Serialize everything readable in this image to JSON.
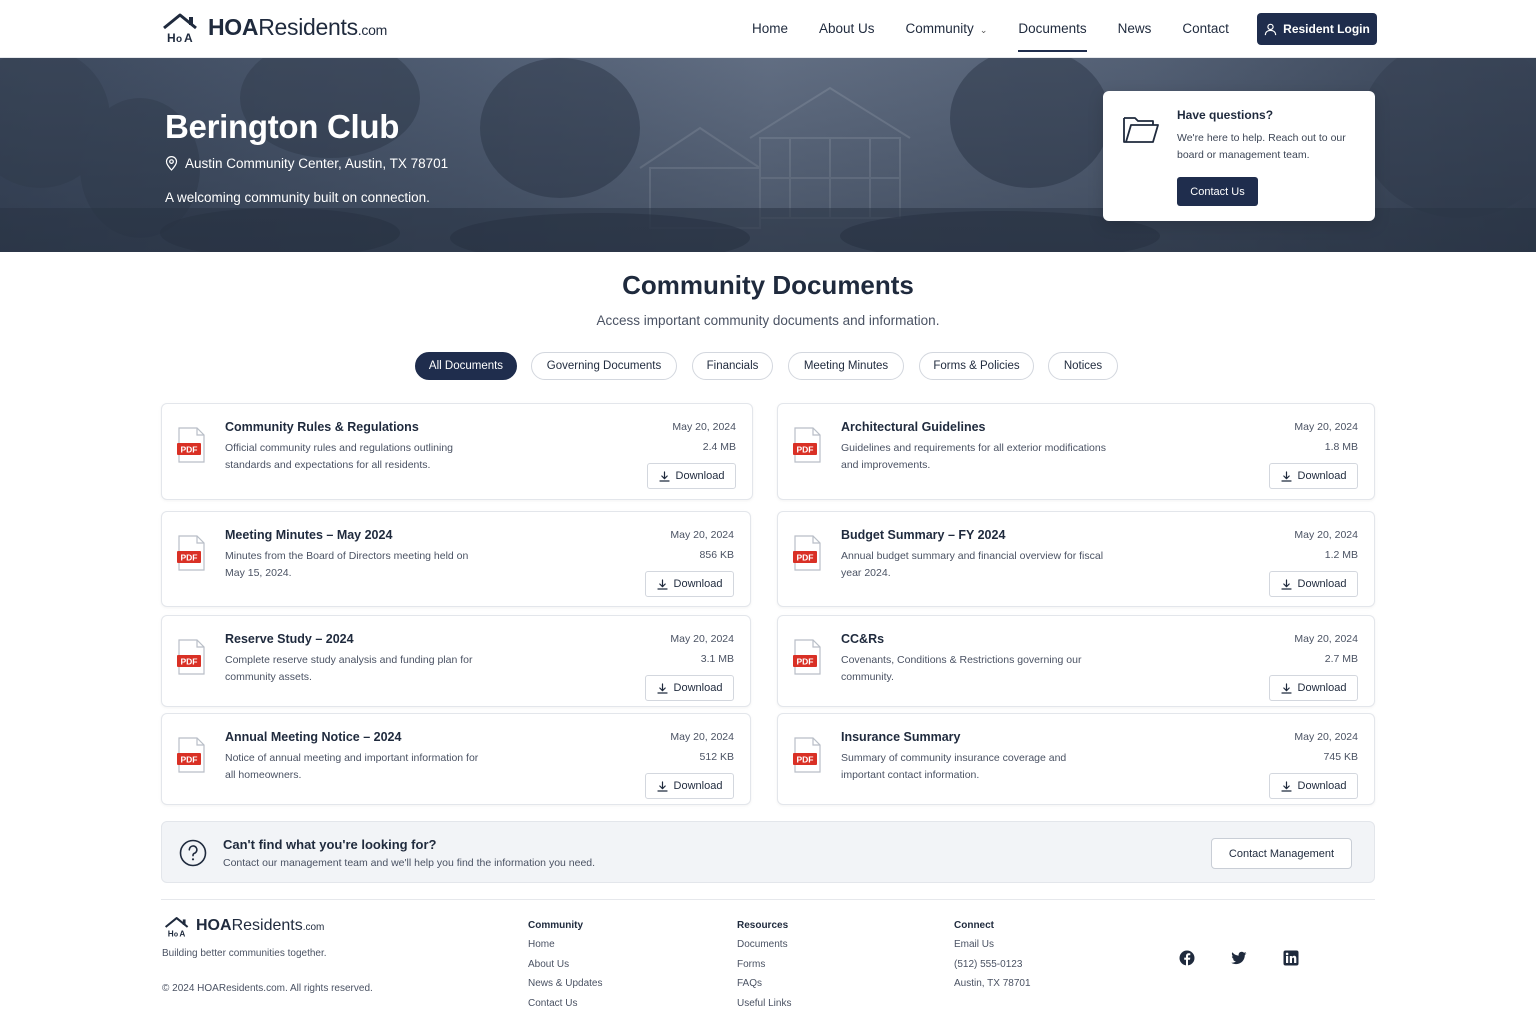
{
  "brand": {
    "name_bold": "HOA",
    "name_rest": "Residents",
    "suffix": ".com"
  },
  "nav": {
    "items": [
      {
        "label": "Home"
      },
      {
        "label": "About Us"
      },
      {
        "label": "Community"
      },
      {
        "label": "Documents"
      },
      {
        "label": "News"
      },
      {
        "label": "Contact"
      }
    ],
    "active": "Documents",
    "login_label": "Resident Login"
  },
  "hero": {
    "title": "Berington Club",
    "location": "Austin Community Center, Austin, TX 78701",
    "tagline": "A welcoming community built on connection.",
    "help": {
      "title": "Have questions?",
      "text": "We're here to help. Reach out to our board or management team.",
      "button": "Contact Us"
    }
  },
  "documents": {
    "title": "Community Documents",
    "subtitle": "Access important community documents and information.",
    "filters": [
      "All Documents",
      "Governing Documents",
      "Financials",
      "Meeting Minutes",
      "Forms & Policies",
      "Notices"
    ],
    "active_filter": "All Documents",
    "download_label": "Download",
    "file_badge": "PDF",
    "items": [
      {
        "title": "Community Rules & Regulations",
        "desc": "Official community rules and regulations outlining standards and expectations for all residents.",
        "date": "May 20, 2024",
        "size": "2.4 MB"
      },
      {
        "title": "Architectural Guidelines",
        "desc": "Guidelines and requirements for all exterior modifications and improvements.",
        "date": "May 20, 2024",
        "size": "1.8 MB"
      },
      {
        "title": "Meeting Minutes – May 2024",
        "desc": "Minutes from the Board of Directors meeting held on May 15, 2024.",
        "date": "May 20, 2024",
        "size": "856 KB"
      },
      {
        "title": "Budget Summary – FY 2024",
        "desc": "Annual budget summary and financial overview for fiscal year 2024.",
        "date": "May 20, 2024",
        "size": "1.2 MB"
      },
      {
        "title": "Reserve Study – 2024",
        "desc": "Complete reserve study analysis and funding plan for community assets.",
        "date": "May 20, 2024",
        "size": "3.1 MB"
      },
      {
        "title": "CC&Rs",
        "desc": "Covenants, Conditions & Restrictions governing our community.",
        "date": "May 20, 2024",
        "size": "2.7 MB"
      },
      {
        "title": "Annual Meeting Notice – 2024",
        "desc": "Notice of annual meeting and important information for all homeowners.",
        "date": "May 20, 2024",
        "size": "512 KB"
      },
      {
        "title": "Insurance Summary",
        "desc": "Summary of community insurance coverage and important contact information.",
        "date": "May 20, 2024",
        "size": "745 KB"
      }
    ]
  },
  "cta": {
    "title": "Can't find what you're looking for?",
    "text": "Contact our management team and we'll help you find the information you need.",
    "button": "Contact Management"
  },
  "footer": {
    "tagline": "Building better communities together.",
    "copyright": "© 2024 HOAResidents.com. All rights reserved.",
    "columns": [
      {
        "heading": "Community",
        "links": [
          "Home",
          "About Us",
          "News & Updates",
          "Contact Us"
        ]
      },
      {
        "heading": "Resources",
        "links": [
          "Documents",
          "Forms",
          "FAQs",
          "Useful Links"
        ]
      },
      {
        "heading": "Connect",
        "links": [
          "Email Us",
          "(512) 555-0123",
          "Austin, TX 78701"
        ]
      }
    ],
    "social": [
      "facebook-icon",
      "twitter-icon",
      "linkedin-icon"
    ]
  },
  "colors": {
    "navy": "#1f2d4d",
    "pdf_red": "#d93025",
    "text": "#1f2a3d",
    "muted": "#4a5263"
  }
}
